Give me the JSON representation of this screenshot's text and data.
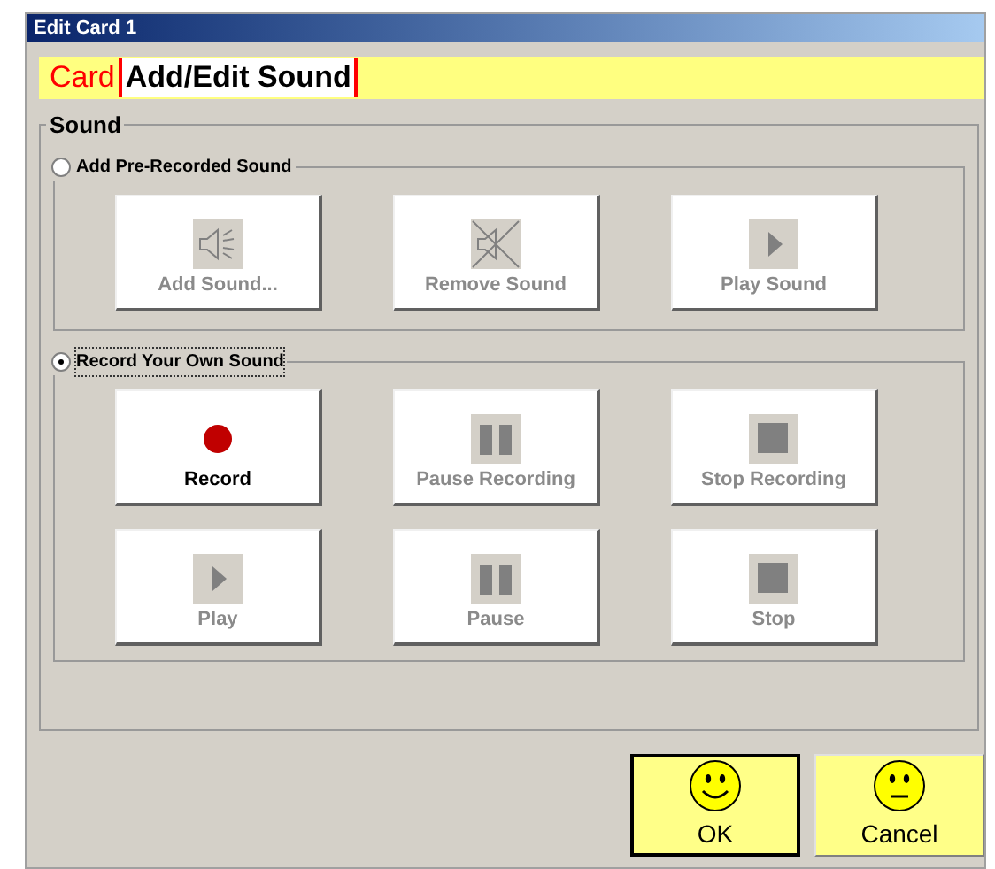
{
  "window": {
    "title": "Edit Card 1"
  },
  "breadcrumb": [
    {
      "label": "Card",
      "selected": false
    },
    {
      "label": "Add/Edit Sound",
      "selected": true
    }
  ],
  "sound_group": {
    "title": "Sound",
    "options": [
      {
        "label": "Add Pre-Recorded Sound",
        "selected": false,
        "buttons": [
          {
            "kind": "speaker",
            "label": "Add Sound...",
            "disabled": true
          },
          {
            "kind": "speaker-crossed",
            "label": "Remove Sound",
            "disabled": true
          },
          {
            "kind": "play",
            "label": "Play Sound",
            "disabled": true
          }
        ]
      },
      {
        "label": "Record Your Own Sound",
        "selected": true,
        "buttons": [
          {
            "kind": "record",
            "label": "Record",
            "disabled": false
          },
          {
            "kind": "pause",
            "label": "Pause Recording",
            "disabled": true
          },
          {
            "kind": "stop",
            "label": "Stop Recording",
            "disabled": true
          },
          {
            "kind": "play",
            "label": "Play",
            "disabled": true
          },
          {
            "kind": "pause",
            "label": "Pause",
            "disabled": true
          },
          {
            "kind": "stop",
            "label": "Stop",
            "disabled": true
          }
        ]
      }
    ]
  },
  "footer_buttons": [
    {
      "kind": "happy",
      "label": "OK"
    },
    {
      "kind": "neutral",
      "label": "Cancel"
    }
  ]
}
